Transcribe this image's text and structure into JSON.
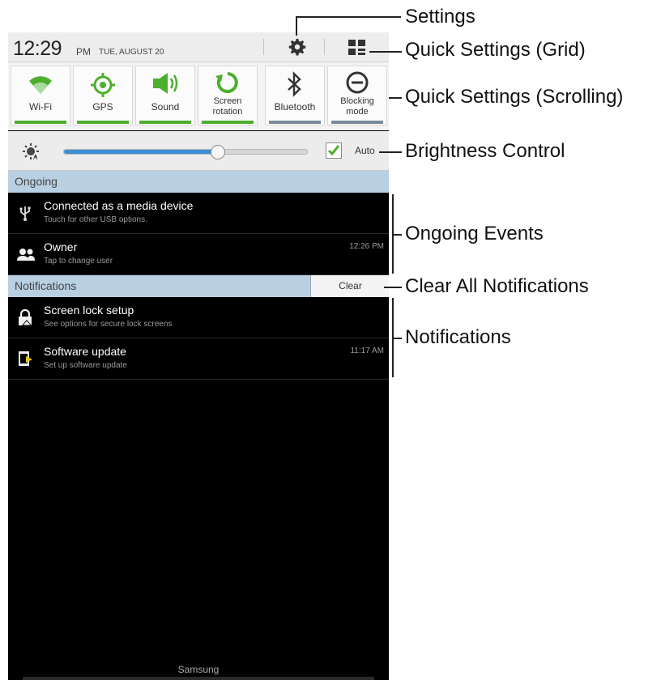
{
  "status": {
    "time": "12:29",
    "ampm": "PM",
    "date": "TUE, AUGUST 20"
  },
  "quick_settings": [
    {
      "label": "Wi-Fi",
      "icon": "wifi-icon",
      "active": true
    },
    {
      "label": "GPS",
      "icon": "gps-icon",
      "active": true
    },
    {
      "label": "Sound",
      "icon": "sound-icon",
      "active": true
    },
    {
      "label": "Screen rotation",
      "icon": "rotation-icon",
      "active": true
    },
    {
      "label": "Bluetooth",
      "icon": "bluetooth-icon",
      "active": false
    },
    {
      "label": "Blocking mode",
      "icon": "blocking-icon",
      "active": false
    }
  ],
  "brightness": {
    "level": 0.63,
    "auto_checked": true,
    "auto_label": "Auto"
  },
  "ongoing": {
    "header": "Ongoing",
    "items": [
      {
        "title": "Connected as a media device",
        "subtitle": "Touch for other USB options.",
        "time": "",
        "icon": "usb-icon"
      },
      {
        "title": "Owner",
        "subtitle": "Tap to change user",
        "time": "12:26 PM",
        "icon": "users-icon"
      }
    ]
  },
  "notifications": {
    "header": "Notifications",
    "clear_label": "Clear",
    "items": [
      {
        "title": "Screen lock setup",
        "subtitle": "See options for secure lock screens",
        "time": "",
        "icon": "lock-icon"
      },
      {
        "title": "Software update",
        "subtitle": "Set up software update",
        "time": "11:17 AM",
        "icon": "update-icon"
      }
    ]
  },
  "footer": "Samsung",
  "callouts": {
    "settings": "Settings",
    "qs_grid": "Quick Settings (Grid)",
    "qs_scrolling": "Quick Settings (Scrolling)",
    "brightness": "Brightness Control",
    "ongoing": "Ongoing Events",
    "clear_all": "Clear All Notifications",
    "notifications": "Notifications"
  },
  "colors": {
    "accent_green": "#4caf2d",
    "inactive_bar": "#7a8a9a",
    "slider_blue": "#3c8fd6",
    "section_blue": "#b9cfe2"
  }
}
